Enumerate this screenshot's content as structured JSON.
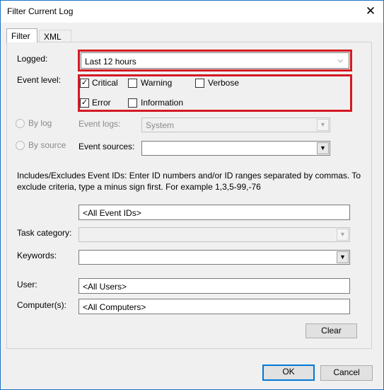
{
  "window": {
    "title": "Filter Current Log"
  },
  "tabs": {
    "filter": "Filter",
    "xml": "XML"
  },
  "logged": {
    "label": "Logged:",
    "value": "Last 12 hours"
  },
  "event_level": {
    "label": "Event level:",
    "critical": "Critical",
    "warning": "Warning",
    "verbose": "Verbose",
    "error": "Error",
    "information": "Information"
  },
  "source": {
    "by_log": "By log",
    "by_source": "By source",
    "event_logs_label": "Event logs:",
    "event_logs_value": "System",
    "event_sources_label": "Event sources:"
  },
  "help_text": "Includes/Excludes Event IDs: Enter ID numbers and/or ID ranges separated by commas. To exclude criteria, type a minus sign first. For example 1,3,5-99,-76",
  "event_ids": {
    "value": "<All Event IDs>"
  },
  "task_category": {
    "label": "Task category:"
  },
  "keywords": {
    "label": "Keywords:"
  },
  "user": {
    "label": "User:",
    "value": "<All Users>"
  },
  "computer": {
    "label": "Computer(s):",
    "value": "<All Computers>"
  },
  "buttons": {
    "clear": "Clear",
    "ok": "OK",
    "cancel": "Cancel"
  },
  "icons": {
    "close": "close-icon",
    "dropdown": "chevron-down-icon",
    "check": "check-icon"
  },
  "colors": {
    "highlight": "#d51924",
    "accent": "#0078d7"
  }
}
